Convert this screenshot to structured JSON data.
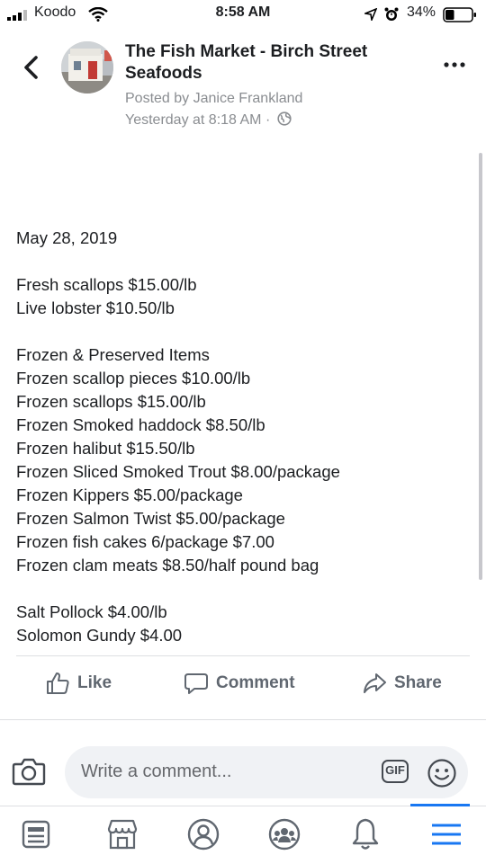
{
  "status_bar": {
    "carrier": "Koodo",
    "time": "8:58 AM",
    "battery_percent": "34%",
    "battery_level": 0.34
  },
  "post": {
    "page_name": "The Fish Market - Birch Street Seafoods",
    "posted_by": "Posted by Janice Frankland",
    "timestamp": "Yesterday at 8:18 AM ·",
    "body_lines": [
      "May 28, 2019",
      "",
      "Fresh scallops $15.00/lb",
      "Live lobster $10.50/lb",
      "",
      "Frozen & Preserved Items",
      "Frozen scallop pieces $10.00/lb",
      "Frozen scallops $15.00/lb",
      "Frozen Smoked haddock $8.50/lb",
      "Frozen halibut $15.50/lb",
      "Frozen Sliced Smoked Trout $8.00/package",
      "Frozen Kippers $5.00/package",
      "Frozen Salmon Twist $5.00/package",
      "Frozen fish cakes 6/package $7.00",
      "Frozen clam meats $8.50/half pound bag",
      "",
      "Salt Pollock $4.00/lb",
      "Solomon Gundy $4.00"
    ]
  },
  "actions": {
    "like": "Like",
    "comment": "Comment",
    "share": "Share"
  },
  "comment_box": {
    "placeholder": "Write a comment...",
    "gif_label": "GIF"
  },
  "icons": {
    "back": "chevron-left-icon",
    "more": "more-dots-icon",
    "globe": "globe-icon",
    "camera": "camera-icon",
    "emoji": "smiley-icon",
    "nav": [
      "news-feed-icon",
      "marketplace-icon",
      "profile-icon",
      "groups-icon",
      "notifications-icon",
      "menu-icon"
    ]
  },
  "colors": {
    "accent": "#1877f2",
    "text": "#1c1e21",
    "secondary_text": "#8a8d91"
  }
}
